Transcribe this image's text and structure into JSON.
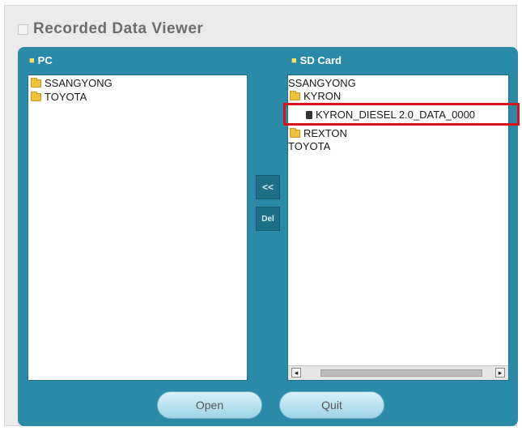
{
  "window": {
    "title": "Recorded Data Viewer"
  },
  "pc_pane": {
    "label": "PC",
    "items": [
      {
        "label": "SSANGYONG",
        "icon": "folder-icon"
      },
      {
        "label": "TOYOTA",
        "icon": "folder-icon"
      }
    ]
  },
  "sd_pane": {
    "label": "SD Card",
    "items": [
      {
        "label": "SSANGYONG"
      },
      {
        "label": "KYRON",
        "icon": "folder-icon"
      },
      {
        "label": "KYRON_DIESEL 2.0_DATA_0000",
        "icon": "file-icon",
        "selected": true
      },
      {
        "label": "REXTON",
        "icon": "folder-icon"
      },
      {
        "label": "TOYOTA"
      }
    ]
  },
  "actions": {
    "copy_label": "<<",
    "delete_label": "Del",
    "open_label": "Open",
    "quit_label": "Quit"
  },
  "scroll": {
    "left_arrow": "◂",
    "right_arrow": "▸"
  },
  "colors": {
    "panel": "#2b8aa7",
    "highlight": "#d8121b",
    "folder": "#f0c23c"
  }
}
